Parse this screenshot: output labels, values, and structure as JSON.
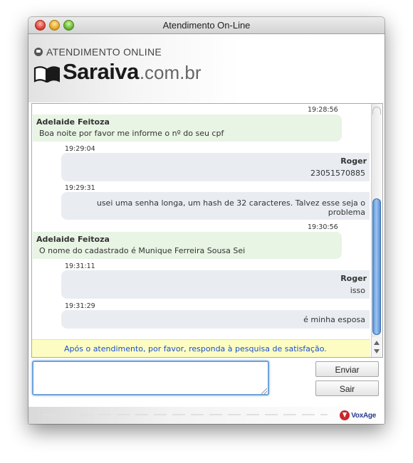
{
  "window": {
    "title": "Atendimento On-Line"
  },
  "header": {
    "atendimento_label": "ATENDIMENTO ONLINE",
    "brand": "Saraiva",
    "domain": ".com.br"
  },
  "messages": [
    {
      "time": "19:28:56",
      "sender": "Adelaide Feitoza",
      "text": "Boa noite por favor me informe o nº do seu cpf"
    },
    {
      "time": "19:29:04",
      "sender": "Roger",
      "text": "23051570885"
    },
    {
      "time": "19:29:31",
      "sender": "",
      "line1": "usei uma senha longa, um hash de 32 caracteres. Talvez esse seja o",
      "line2": "problema"
    },
    {
      "time": "19:30:56",
      "sender": "Adelaide Feitoza",
      "text": "O nome do cadastrado é Munique Ferreira Sousa Sei"
    },
    {
      "time": "19:31:11",
      "sender": "Roger",
      "text": "isso"
    },
    {
      "time": "19:31:29",
      "sender": "",
      "text": "é minha esposa"
    }
  ],
  "survey_notice": "Após o atendimento, por favor, responda à pesquisa de satisfação.",
  "input": {
    "value": ""
  },
  "buttons": {
    "send": "Enviar",
    "exit": "Sair"
  },
  "footer": {
    "brand": "VoxAge"
  },
  "colors": {
    "agent_bubble": "#e8f4e4",
    "user_bubble": "#e9edf2",
    "notice_bg": "#fdfdc3",
    "notice_text": "#1a4fd0"
  }
}
